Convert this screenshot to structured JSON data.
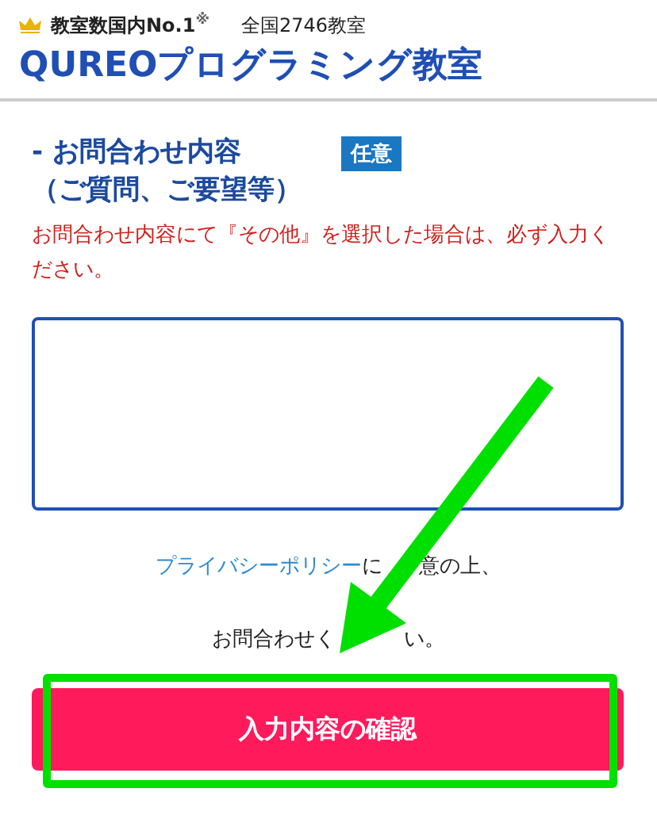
{
  "header": {
    "tagline": "教室数国内No.1",
    "tagline_mark": "※",
    "count": "全国2746教室",
    "logo": "QUREOプログラミング教室"
  },
  "field": {
    "label_line1": "- お問合わせ内容",
    "label_line2": "（ご質問、ご要望等）",
    "badge": "任意",
    "note": "お問合わせ内容にて『その他』を選択した場合は、必ず入力ください。"
  },
  "consent": {
    "link": "プライバシーポリシー",
    "text_after_link": "に",
    "text_tail": "意の上、",
    "line2_start": "お問合わせく",
    "line2_end": "い。"
  },
  "submit_button": "入力内容の確認"
}
